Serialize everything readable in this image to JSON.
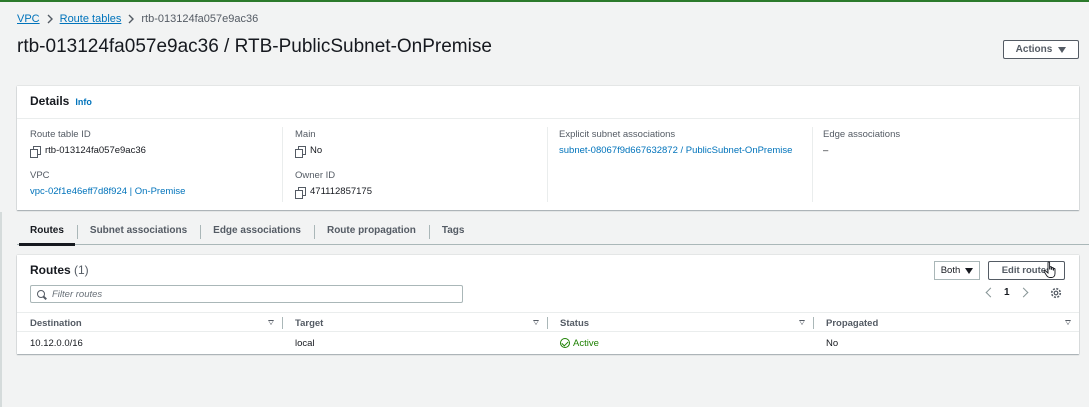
{
  "breadcrumb": {
    "vpc": "VPC",
    "route_tables": "Route tables",
    "current": "rtb-013124fa057e9ac36"
  },
  "page": {
    "title": "rtb-013124fa057e9ac36 / RTB-PublicSubnet-OnPremise",
    "actions_label": "Actions"
  },
  "details": {
    "title": "Details",
    "info": "Info",
    "route_table_id_label": "Route table ID",
    "route_table_id": "rtb-013124fa057e9ac36",
    "vpc_label": "VPC",
    "vpc": "vpc-02f1e46eff7d8f924 | On-Premise",
    "main_label": "Main",
    "main": "No",
    "owner_id_label": "Owner ID",
    "owner_id": "471112857175",
    "explicit_label": "Explicit subnet associations",
    "explicit": "subnet-08067f9d667632872 / PublicSubnet-OnPremise",
    "edge_label": "Edge associations",
    "edge": "–"
  },
  "tabs": [
    "Routes",
    "Subnet associations",
    "Edge associations",
    "Route propagation",
    "Tags"
  ],
  "routes": {
    "title": "Routes",
    "count": "(1)",
    "filter_select": "Both",
    "edit_label": "Edit routes",
    "filter_placeholder": "Filter routes",
    "page": "1",
    "columns": [
      "Destination",
      "Target",
      "Status",
      "Propagated"
    ],
    "rows": [
      {
        "destination": "10.12.0.0/16",
        "target": "local",
        "status": "Active",
        "propagated": "No"
      }
    ]
  },
  "colors": {
    "link": "#0073bb",
    "active": "#1d8102",
    "header_green": "#2b7a2b"
  }
}
